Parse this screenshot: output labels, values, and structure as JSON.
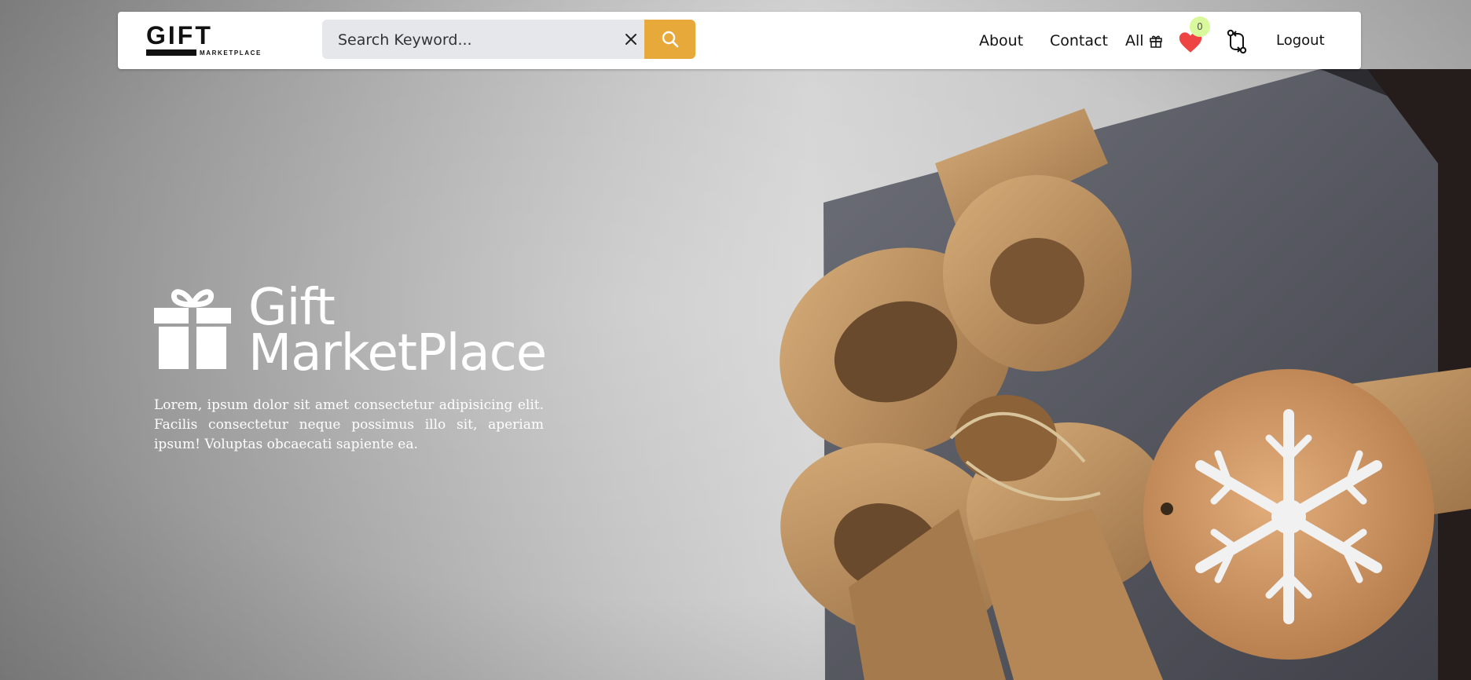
{
  "header": {
    "logo_big": "GIFT",
    "logo_small": "MARKETPLACE",
    "search": {
      "placeholder": "Search Keyword...",
      "value": ""
    },
    "nav": {
      "about": "About",
      "contact": "Contact",
      "all": "All",
      "logout": "Logout"
    },
    "wishlist_count": "0"
  },
  "hero": {
    "title_line1": "Gift",
    "title_line2": "MarketPlace",
    "description": "Lorem, ipsum dolor sit amet consectetur adipisicing elit. Facilis consectetur neque possimus illo sit, aperiam ipsum! Voluptas obcaecati sapiente ea."
  },
  "icons": {
    "clear": "close-icon",
    "search": "search-icon",
    "all": "gift-icon",
    "wishlist": "heart-icon",
    "compare": "compare-arrows-icon",
    "hero": "gift-icon",
    "photo": "gift-box-photo"
  },
  "colors": {
    "accent": "#e8a93b",
    "heart": "#ef4444",
    "badge": "#d9f99d",
    "search_bg": "#e5e7eb",
    "nav_bg": "#ffffff",
    "box_paper": "#5b5d66",
    "ribbon": "#c49a6c",
    "tag": "#d9a070"
  }
}
